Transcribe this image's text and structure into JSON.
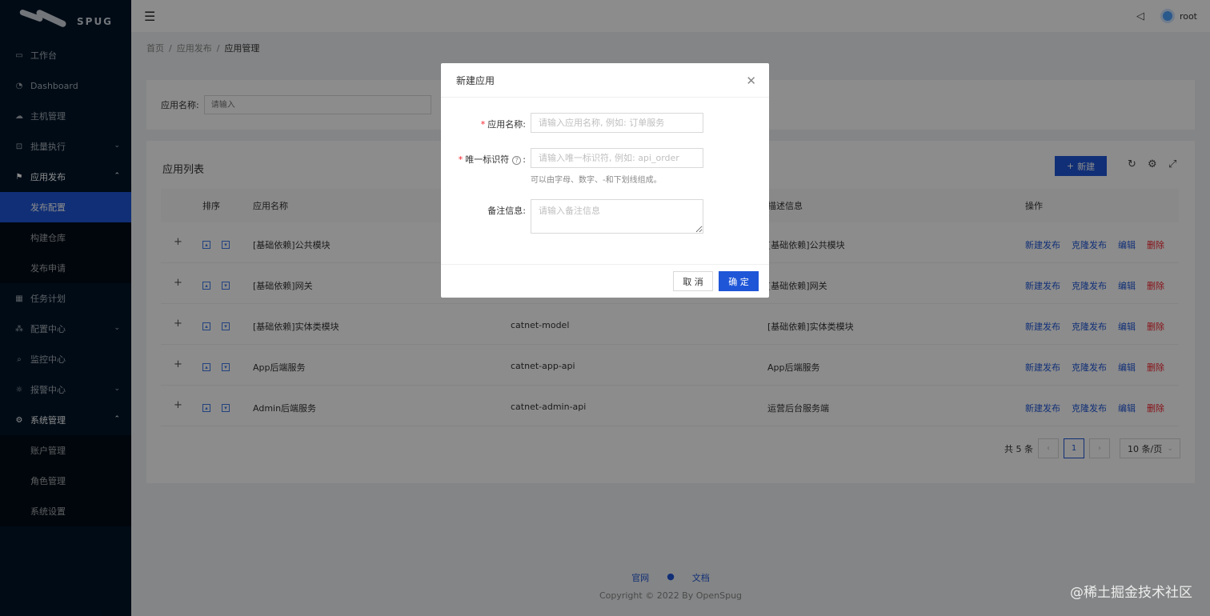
{
  "app": {
    "logo_text": "SPUG"
  },
  "sidebar": {
    "items": [
      {
        "label": "工作台",
        "icon": "desktop-icon"
      },
      {
        "label": "Dashboard",
        "icon": "dashboard-icon"
      },
      {
        "label": "主机管理",
        "icon": "cloud-icon"
      },
      {
        "label": "批量执行",
        "icon": "code-icon",
        "expandable": true
      },
      {
        "label": "应用发布",
        "icon": "flag-icon",
        "expandable": true,
        "open": true
      },
      {
        "label": "任务计划",
        "icon": "schedule-icon"
      },
      {
        "label": "配置中心",
        "icon": "deployment-icon",
        "expandable": true
      },
      {
        "label": "监控中心",
        "icon": "monitor-icon"
      },
      {
        "label": "报警中心",
        "icon": "alert-icon",
        "expandable": true
      },
      {
        "label": "系统管理",
        "icon": "setting-icon",
        "expandable": true,
        "open": true
      }
    ],
    "deploy_sub": [
      "发布配置",
      "构建仓库",
      "发布申请"
    ],
    "system_sub": [
      "账户管理",
      "角色管理",
      "系统设置"
    ]
  },
  "header": {
    "user": "root"
  },
  "breadcrumb": [
    "首页",
    "应用发布",
    "应用管理"
  ],
  "search": {
    "label": "应用名称:",
    "placeholder": "请输入"
  },
  "table": {
    "title": "应用列表",
    "new_label": "新建",
    "columns": {
      "sort": "排序",
      "name": "应用名称",
      "desc": "描述信息",
      "ops": "操作"
    },
    "rows": [
      {
        "name": "[基础依赖]公共模块",
        "key": "",
        "desc": "[基础依赖]公共模块"
      },
      {
        "name": "[基础依赖]网关",
        "key": "",
        "desc": "[基础依赖]网关"
      },
      {
        "name": "[基础依赖]实体类模块",
        "key": "catnet-model",
        "desc": "[基础依赖]实体类模块"
      },
      {
        "name": "App后端服务",
        "key": "catnet-app-api",
        "desc": "App后端服务"
      },
      {
        "name": "Admin后端服务",
        "key": "catnet-admin-api",
        "desc": "运营后台服务端"
      }
    ],
    "actions": {
      "new_deploy": "新建发布",
      "clone_deploy": "克隆发布",
      "edit": "编辑",
      "delete": "删除"
    },
    "pagination": {
      "total": "共 5 条",
      "current": "1",
      "page_size": "10 条/页"
    }
  },
  "footer": {
    "links": [
      "官网",
      "文档"
    ],
    "copyright": "Copyright © 2022 By OpenSpug"
  },
  "watermark": "@稀土掘金技术社区",
  "modal": {
    "title": "新建应用",
    "name_label": "应用名称:",
    "name_placeholder": "请输入应用名称, 例如: 订单服务",
    "key_label": "唯一标识符",
    "key_placeholder": "请输入唯一标识符, 例如: api_order",
    "key_hint": "可以由字母、数字、-和下划线组成。",
    "desc_label": "备注信息:",
    "desc_placeholder": "请输入备注信息",
    "cancel": "取 消",
    "ok": "确 定"
  },
  "colors": {
    "primary": "#1f56d8",
    "sidebar_bg": "#001529",
    "danger": "#f5222d"
  }
}
